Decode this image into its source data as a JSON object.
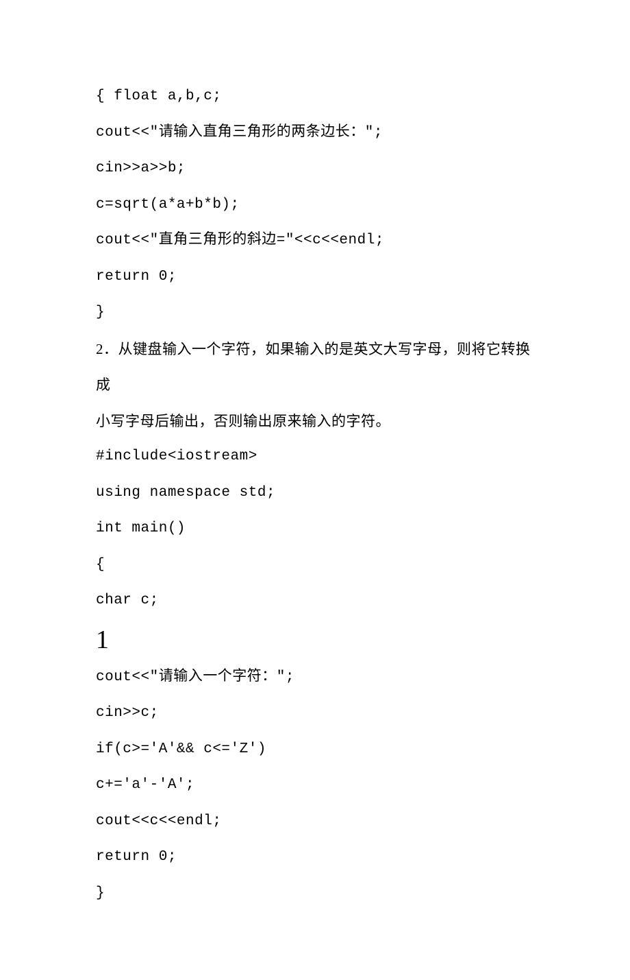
{
  "lines": {
    "l1": "{ float a,b,c;",
    "l2": "cout<<\"请输入直角三角形的两条边长：\";",
    "l3": "cin>>a>>b;",
    "l4": "c=sqrt(a*a+b*b);",
    "l5": "cout<<\"直角三角形的斜边=\"<<c<<endl;",
    "l6": "return 0;",
    "l7": "}",
    "l8": "2．从键盘输入一个字符，如果输入的是英文大写字母，则将它转换成",
    "l9": "小写字母后输出，否则输出原来输入的字符。",
    "l10": "#include<iostream>",
    "l11": "using namespace std;",
    "l12": "int main()",
    "l13": "{",
    "l14": "char c;",
    "big": "1",
    "l15": "cout<<\"请输入一个字符：\";",
    "l16": "cin>>c;",
    "l17": "if(c>='A'&& c<='Z')",
    "l18": "c+='a'-'A';",
    "l19": "cout<<c<<endl;",
    "l20": "return 0;",
    "l21": "}"
  }
}
